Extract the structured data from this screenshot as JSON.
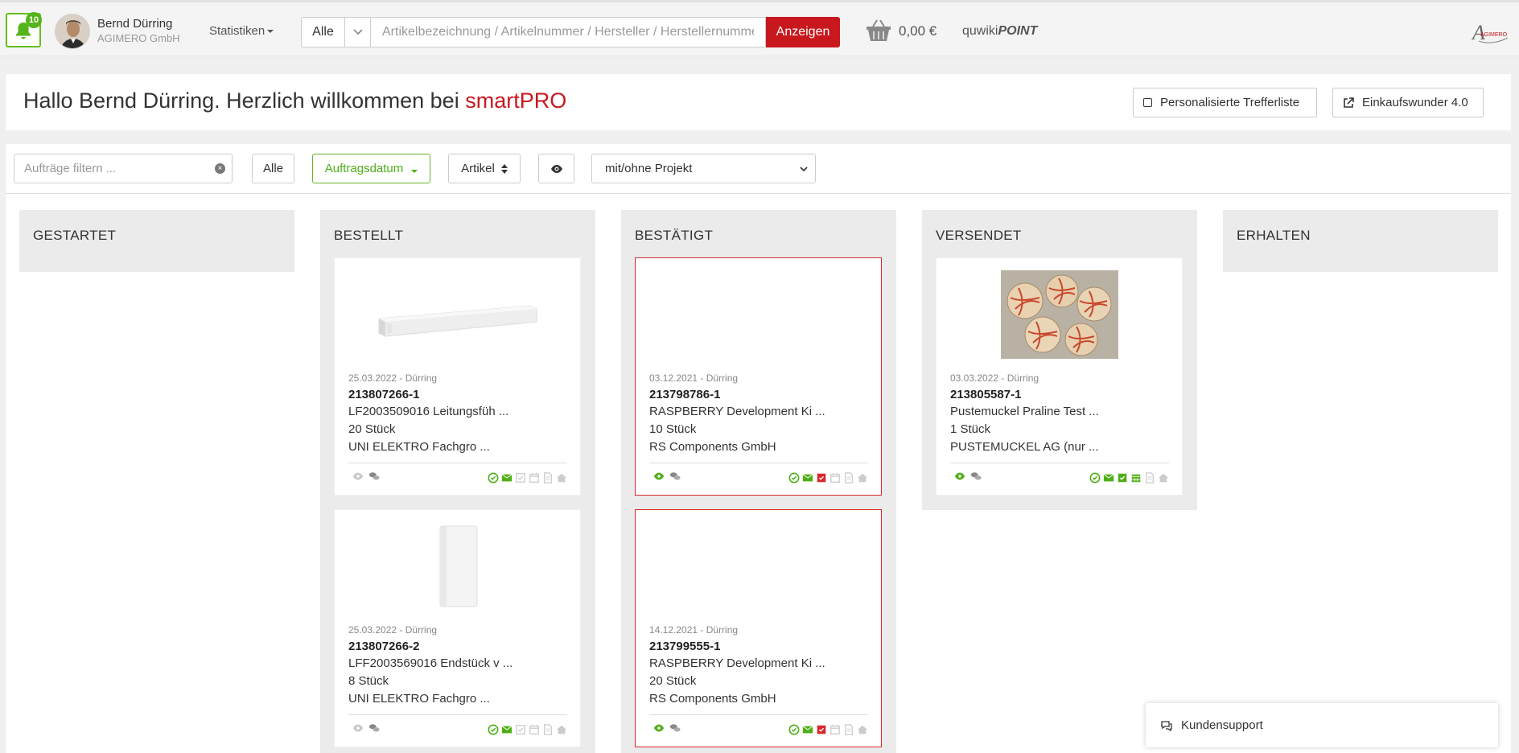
{
  "header": {
    "notification_count": "10",
    "user_name": "Bernd Dürring",
    "user_company": "AGIMERO GmbH",
    "stats_label": "Statistiken",
    "search_scope": "Alle",
    "search_placeholder": "Artikelbezeichnung / Artikelnummer / Hersteller / Herstellernummer",
    "search_button": "Anzeigen",
    "cart_amount": "0,00 €",
    "quwiki_prefix": "quwiki",
    "quwiki_suffix": "POINT",
    "logo_text": "AGIMERO"
  },
  "welcome": {
    "text": "Hallo Bernd Dürring. Herzlich willkommen bei ",
    "brand": "smartPRO",
    "btn_personalized": "Personalisierte Trefferliste",
    "btn_einkauf": "Einkaufswunder 4.0"
  },
  "filters": {
    "placeholder": "Aufträge filtern ...",
    "all": "Alle",
    "date": "Auftragsdatum",
    "article": "Artikel",
    "project": "mit/ohne Projekt"
  },
  "columns": [
    {
      "title": "GESTARTET"
    },
    {
      "title": "BESTELLT"
    },
    {
      "title": "BESTÄTIGT"
    },
    {
      "title": "VERSENDET"
    },
    {
      "title": "ERHALTEN"
    }
  ],
  "cards": {
    "b1": {
      "meta": "25.03.2022 - Dürring",
      "num": "213807266-1",
      "l1": "LF2003509016 Leitungsfüh ...",
      "l2": "20 Stück",
      "l3": "UNI ELEKTRO Fachgro ..."
    },
    "b2": {
      "meta": "25.03.2022 - Dürring",
      "num": "213807266-2",
      "l1": "LFF2003569016 Endstück v ...",
      "l2": "8 Stück",
      "l3": "UNI ELEKTRO Fachgro ..."
    },
    "c1": {
      "meta": "03.12.2021 - Dürring",
      "num": "213798786-1",
      "l1": "RASPBERRY Development Ki ...",
      "l2": "10 Stück",
      "l3": "RS Components GmbH"
    },
    "c2": {
      "meta": "14.12.2021 - Dürring",
      "num": "213799555-1",
      "l1": "RASPBERRY Development Ki ...",
      "l2": "20 Stück",
      "l3": "RS Components GmbH"
    },
    "v1": {
      "meta": "03.03.2022 - Dürring",
      "num": "213805587-1",
      "l1": "Pustemuckel Praline Test ...",
      "l2": "1 Stück",
      "l3": "PUSTEMUCKEL AG (nur ..."
    }
  },
  "support": {
    "label": "Kundensupport"
  },
  "colors": {
    "brand_red": "#c8181e",
    "green": "#4fae17",
    "gray_icon": "#cccccc"
  }
}
